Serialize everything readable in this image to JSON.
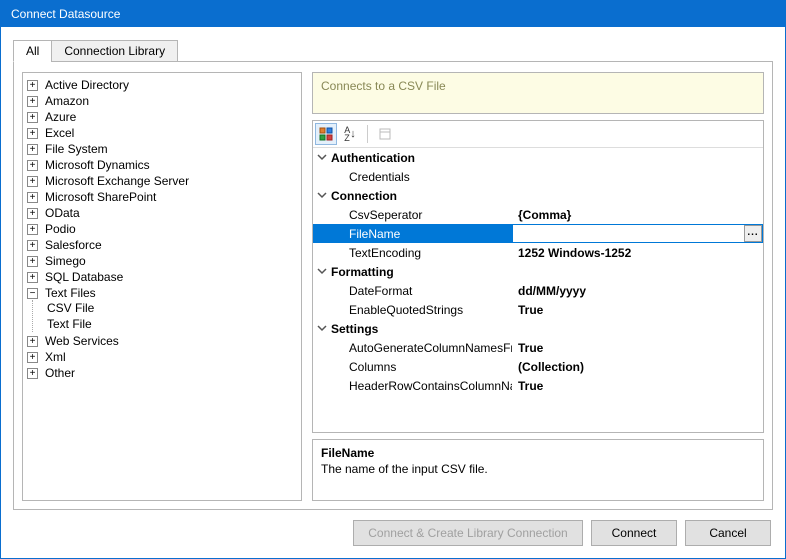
{
  "window": {
    "title": "Connect Datasource"
  },
  "tabs": [
    {
      "label": "All",
      "active": true
    },
    {
      "label": "Connection Library",
      "active": false
    }
  ],
  "tree": {
    "items": [
      {
        "label": "Active Directory",
        "expandable": true,
        "expanded": false
      },
      {
        "label": "Amazon",
        "expandable": true,
        "expanded": false
      },
      {
        "label": "Azure",
        "expandable": true,
        "expanded": false
      },
      {
        "label": "Excel",
        "expandable": true,
        "expanded": false
      },
      {
        "label": "File System",
        "expandable": true,
        "expanded": false
      },
      {
        "label": "Microsoft Dynamics",
        "expandable": true,
        "expanded": false
      },
      {
        "label": "Microsoft Exchange Server",
        "expandable": true,
        "expanded": false
      },
      {
        "label": "Microsoft SharePoint",
        "expandable": true,
        "expanded": false
      },
      {
        "label": "OData",
        "expandable": true,
        "expanded": false
      },
      {
        "label": "Podio",
        "expandable": true,
        "expanded": false
      },
      {
        "label": "Salesforce",
        "expandable": true,
        "expanded": false
      },
      {
        "label": "Simego",
        "expandable": true,
        "expanded": false
      },
      {
        "label": "SQL Database",
        "expandable": true,
        "expanded": false
      },
      {
        "label": "Text Files",
        "expandable": true,
        "expanded": true,
        "children": [
          {
            "label": "CSV File"
          },
          {
            "label": "Text File"
          }
        ]
      },
      {
        "label": "Web Services",
        "expandable": true,
        "expanded": false
      },
      {
        "label": "Xml",
        "expandable": true,
        "expanded": false
      },
      {
        "label": "Other",
        "expandable": true,
        "expanded": false
      }
    ]
  },
  "banner": {
    "text": "Connects to a CSV File"
  },
  "toolbar": {
    "categorized_icon": "categorized-icon",
    "alpha_icon": "alpha-sort-icon",
    "pages_icon": "property-pages-icon"
  },
  "properties": {
    "groups": [
      {
        "name": "Authentication",
        "items": [
          {
            "name": "Credentials",
            "value": ""
          }
        ]
      },
      {
        "name": "Connection",
        "items": [
          {
            "name": "CsvSeperator",
            "value": "{Comma}"
          },
          {
            "name": "FileName",
            "value": "",
            "selected": true,
            "browse": true
          },
          {
            "name": "TextEncoding",
            "value": "1252    Windows-1252"
          }
        ]
      },
      {
        "name": "Formatting",
        "items": [
          {
            "name": "DateFormat",
            "value": "dd/MM/yyyy"
          },
          {
            "name": "EnableQuotedStrings",
            "value": "True"
          }
        ]
      },
      {
        "name": "Settings",
        "items": [
          {
            "name": "AutoGenerateColumnNamesFromHeader",
            "value": "True"
          },
          {
            "name": "Columns",
            "value": "(Collection)"
          },
          {
            "name": "HeaderRowContainsColumnNames",
            "value": "True"
          }
        ]
      }
    ]
  },
  "description": {
    "title": "FileName",
    "text": "The name of the input CSV file."
  },
  "buttons": {
    "connect_create": "Connect & Create Library Connection",
    "connect": "Connect",
    "cancel": "Cancel"
  }
}
